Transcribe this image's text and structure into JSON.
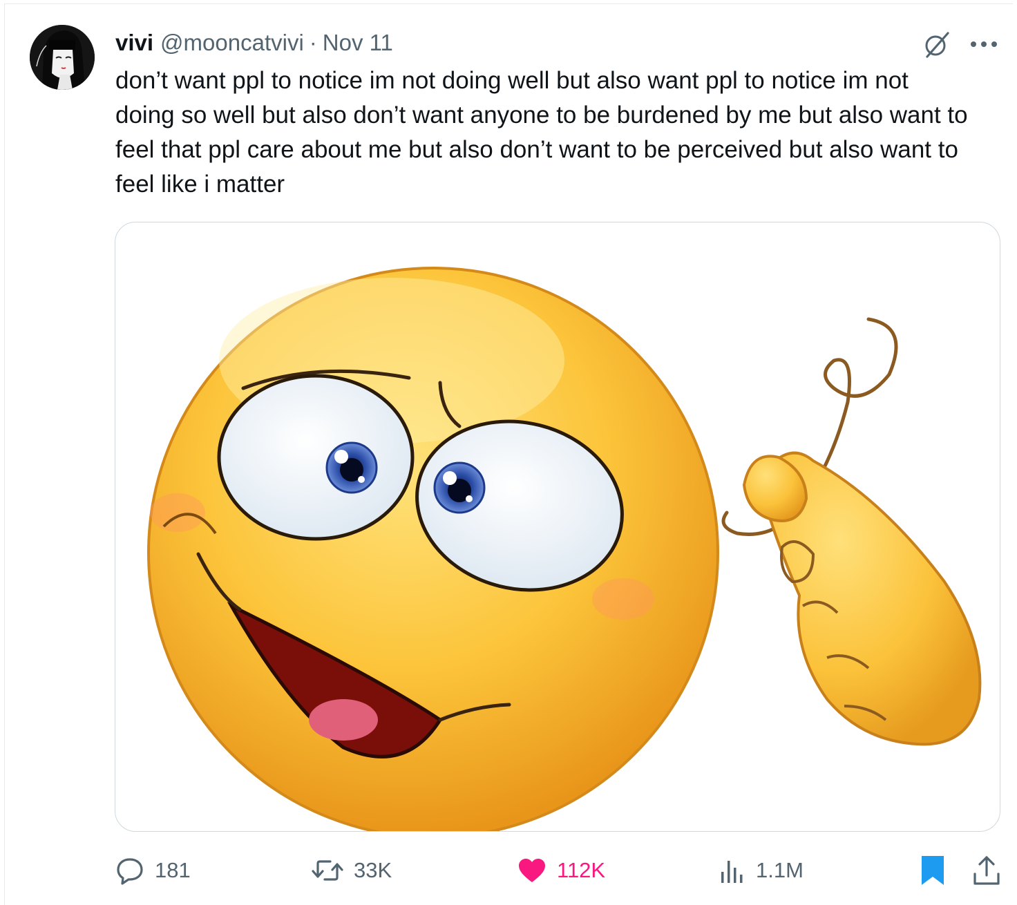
{
  "tweet": {
    "author_name": "vivi",
    "author_handle": "@mooncatvivi",
    "separator": "·",
    "date": "Nov 11",
    "text": "don’t want ppl to notice im not doing well but also want ppl to notice im not doing so well but also don’t want anyone to be burdened by me but also want to feel that ppl care about me but also don’t want to be perceived but also want to feel like i matter"
  },
  "actions": {
    "replies": "181",
    "reposts": "33K",
    "likes": "112K",
    "views": "1.1M"
  },
  "icons": {
    "reply": "speech-bubble-icon",
    "repost": "repost-arrows-icon",
    "like": "heart-filled-icon",
    "views": "bar-chart-icon",
    "bookmark": "bookmark-filled-icon",
    "share": "share-upload-icon",
    "grok": "grok-slash-icon",
    "more": "ellipsis-icon"
  },
  "colors": {
    "text": "#0f1419",
    "secondary": "#536471",
    "like": "#f91880",
    "bookmark": "#1d9bf0",
    "border": "#cfd9de"
  }
}
